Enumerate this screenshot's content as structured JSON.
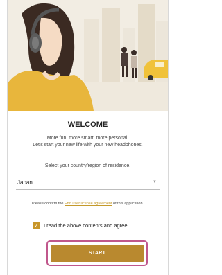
{
  "welcome": {
    "title": "WELCOME",
    "tagline_line1": "More fun, more smart, more personal.",
    "tagline_line2": "Let's start your new life with your new headphones."
  },
  "region": {
    "label": "Select your country/region of residence.",
    "selected": "Japan"
  },
  "license": {
    "prefix": "Please confirm the ",
    "link": "End user license agreement",
    "suffix": " of this application."
  },
  "agreement": {
    "checked": true,
    "label": "I read the above contents and agree."
  },
  "start": {
    "label": "START"
  },
  "colors": {
    "accent": "#c8962a",
    "highlight_border": "#c0578c",
    "hero_yellow": "#e8b63c"
  },
  "icons": {
    "select_caret": "chevron-down-icon",
    "checkbox": "check-icon"
  }
}
